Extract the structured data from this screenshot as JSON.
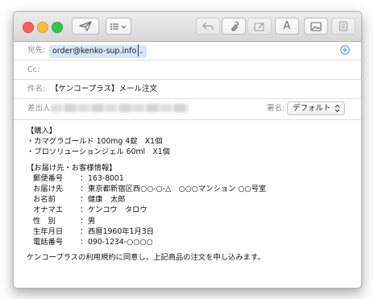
{
  "header": {
    "to_label": "宛先:",
    "to_value": "order@kenko-sup.info",
    "cc_label": "Cc:",
    "subject_label": "件名:",
    "subject_value": "【ケンコープラス】メール注文",
    "from_label": "差出人:",
    "signature_label": "署名:",
    "signature_value": "デフォルト"
  },
  "body": {
    "order_heading": "【購入】",
    "items": [
      "・カマグラゴールド 100mg 4錠　X1個",
      "・プロソリューションジェル  60ml　X1個"
    ],
    "customer_heading": "【お届け先・お客様情報】",
    "fields": [
      {
        "label": "郵便番号",
        "value": "163-8001"
      },
      {
        "label": "お届け先",
        "value": "東京都新宿区西○○-○-△　○○○マンション ○○号室"
      },
      {
        "label": "お名前",
        "value": "健康　太郎"
      },
      {
        "label": "オナマエ",
        "value": "ケンコウ　タロウ"
      },
      {
        "label": "性　別",
        "value": "男"
      },
      {
        "label": "生年月日",
        "value": "西暦1960年1月3日"
      },
      {
        "label": "電話番号",
        "value": "090-1234-○○○○"
      }
    ],
    "separator": "：",
    "closing": "ケンコープラスの利用規約に同意し、上記商品の注文を申し込みます。"
  },
  "colors": {
    "token_bg": "#d6e5fb",
    "add_icon": "#3a8ef6"
  }
}
